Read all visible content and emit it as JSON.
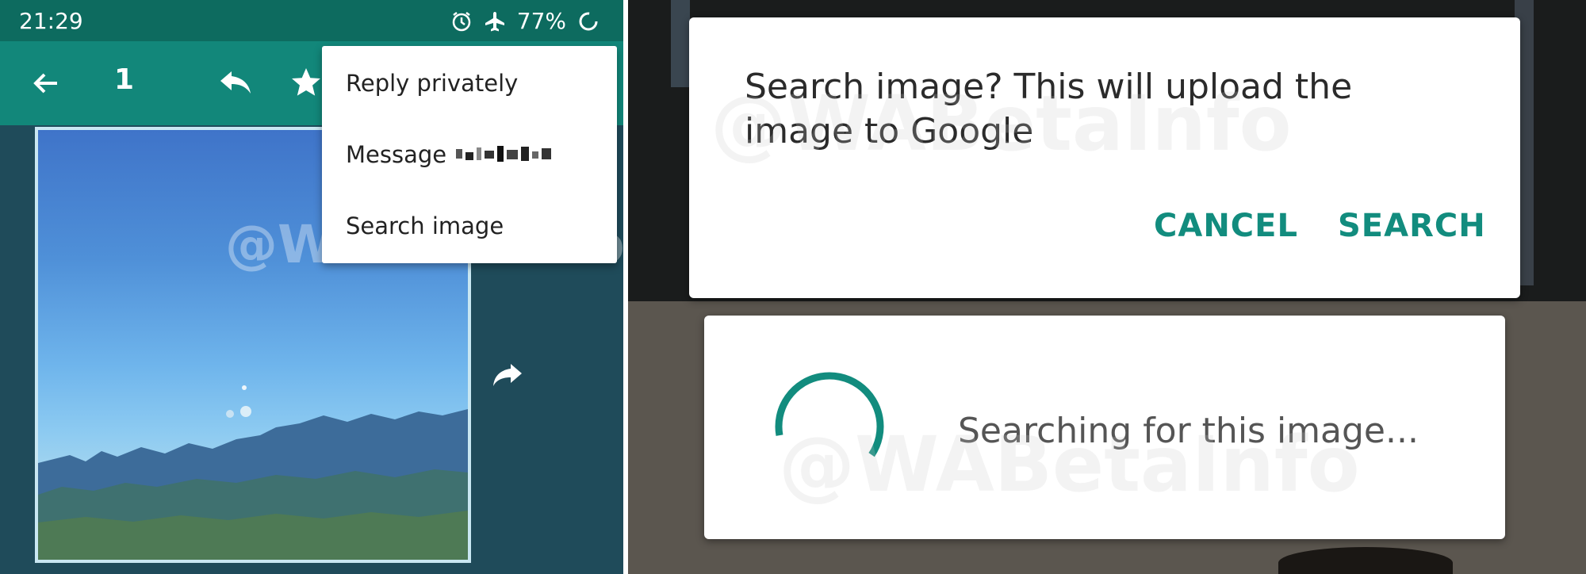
{
  "status_bar": {
    "time": "21:29",
    "battery": "77%"
  },
  "toolbar": {
    "selected_count": "1"
  },
  "menu": {
    "items": [
      {
        "label": "Reply privately"
      },
      {
        "label": "Message"
      },
      {
        "label": "Search image"
      }
    ]
  },
  "dialog": {
    "message": "Search image? This will upload the image to Google",
    "cancel_label": "CANCEL",
    "search_label": "SEARCH"
  },
  "progress": {
    "text": "Searching for this image..."
  },
  "watermark": {
    "text": "@WABetaInfo"
  },
  "colors": {
    "header": "#12877a",
    "status_bar": "#0d6b5f",
    "accent": "#128c7e",
    "chat_bg": "#1f4b5a"
  }
}
